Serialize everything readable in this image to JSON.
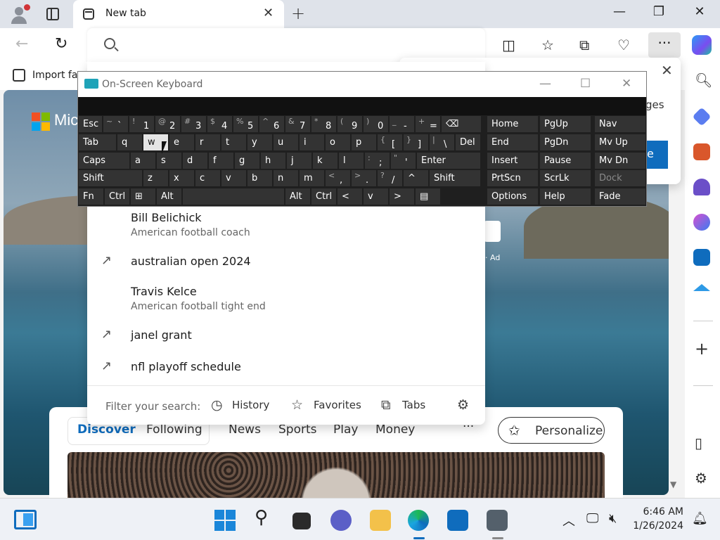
{
  "browser": {
    "tab_title": "New tab",
    "favorites_import": "Import fa",
    "page_logo_text": "Mic",
    "ad_label": "Ad",
    "popup_text": "ges",
    "popup_button": "e"
  },
  "suggestions": [
    {
      "title": "Bill Belichick",
      "subtitle": "American football coach",
      "trending": false
    },
    {
      "title": "australian open 2024",
      "subtitle": "",
      "trending": true
    },
    {
      "title": "Travis Kelce",
      "subtitle": "American football tight end",
      "trending": false
    },
    {
      "title": "janel grant",
      "subtitle": "",
      "trending": true
    },
    {
      "title": "nfl playoff schedule",
      "subtitle": "",
      "trending": true
    }
  ],
  "filter": {
    "label": "Filter your search:",
    "history": "History",
    "favorites": "Favorites",
    "tabs": "Tabs"
  },
  "feed": {
    "tabs": [
      "Discover",
      "Following",
      "News",
      "Sports",
      "Play",
      "Money"
    ],
    "more": "···",
    "personalize": "Personalize"
  },
  "osk": {
    "title": "On-Screen Keyboard",
    "row1": [
      {
        "m": "Esc",
        "s": ""
      },
      {
        "m": "`",
        "s": "~"
      },
      {
        "m": "1",
        "s": "!"
      },
      {
        "m": "2",
        "s": "@"
      },
      {
        "m": "3",
        "s": "#"
      },
      {
        "m": "4",
        "s": "$"
      },
      {
        "m": "5",
        "s": "%"
      },
      {
        "m": "6",
        "s": "^"
      },
      {
        "m": "7",
        "s": "&"
      },
      {
        "m": "8",
        "s": "*"
      },
      {
        "m": "9",
        "s": "("
      },
      {
        "m": "0",
        "s": ")"
      },
      {
        "m": "-",
        "s": "_"
      },
      {
        "m": "=",
        "s": "+"
      },
      {
        "m": "⌫",
        "s": ""
      }
    ],
    "row2": [
      "Tab",
      "q",
      "w",
      "e",
      "r",
      "t",
      "y",
      "u",
      "i",
      "o",
      "p",
      "[",
      "]",
      "\\",
      "Del"
    ],
    "row2_shift": [
      "",
      "",
      "",
      "",
      "",
      "",
      "",
      "",
      "",
      "",
      "",
      "{",
      "}",
      "|",
      ""
    ],
    "row3": [
      "Caps",
      "a",
      "s",
      "d",
      "f",
      "g",
      "h",
      "j",
      "k",
      "l",
      ";",
      "'",
      "Enter"
    ],
    "row3_shift": [
      "",
      "",
      "",
      "",
      "",
      "",
      "",
      "",
      "",
      "",
      ":",
      "\"",
      ""
    ],
    "row4": [
      "Shift",
      "z",
      "x",
      "c",
      "v",
      "b",
      "n",
      "m",
      ",",
      ".",
      "/",
      "^",
      "Shift"
    ],
    "row4_shift": [
      "",
      "",
      "",
      "",
      "",
      "",
      "",
      "",
      "<",
      ">",
      "?",
      "",
      ""
    ],
    "row5": [
      "Fn",
      "Ctrl",
      "⊞",
      "Alt",
      "",
      "Alt",
      "Ctrl",
      "<",
      "v",
      ">",
      "▤"
    ],
    "right_cols": [
      [
        "Home",
        "End",
        "Insert",
        "PrtScn",
        "Options"
      ],
      [
        "PgUp",
        "PgDn",
        "Pause",
        "ScrLk",
        "Help"
      ],
      [
        "Nav",
        "Mv Up",
        "Mv Dn",
        "Dock",
        "Fade"
      ]
    ]
  },
  "clock": {
    "time": "6:46 AM",
    "date": "1/26/2024"
  }
}
